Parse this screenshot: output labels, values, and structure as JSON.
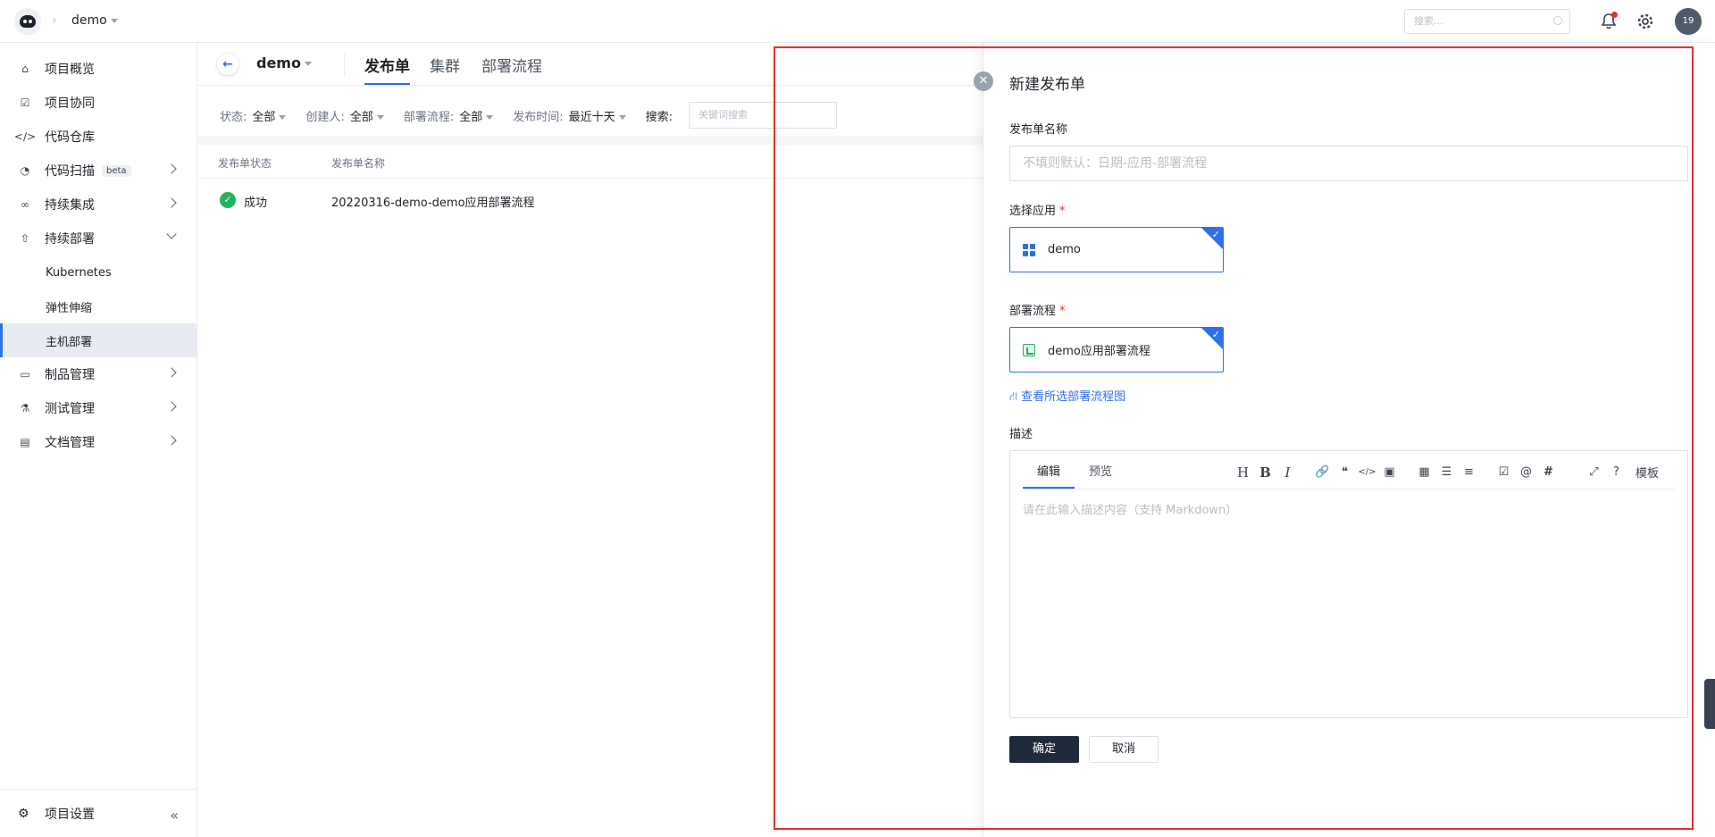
{
  "topbar": {
    "project": "demo",
    "search_placeholder": "搜索...",
    "avatar": "19",
    "icons": [
      "bell-icon",
      "gear-icon"
    ]
  },
  "sidebar": {
    "items": [
      {
        "label": "项目概览",
        "icon": "home-icon"
      },
      {
        "label": "项目协同",
        "icon": "check-square-icon"
      },
      {
        "label": "代码仓库",
        "icon": "code-icon"
      },
      {
        "label": "代码扫描",
        "icon": "scan-icon",
        "badge": "beta"
      },
      {
        "label": "持续集成",
        "icon": "infinity-icon"
      },
      {
        "label": "持续部署",
        "icon": "rocket-icon"
      },
      {
        "label": "Kubernetes"
      },
      {
        "label": "弹性伸缩"
      },
      {
        "label": "主机部署"
      },
      {
        "label": "制品管理",
        "icon": "box-icon"
      },
      {
        "label": "测试管理",
        "icon": "flask-icon"
      },
      {
        "label": "文档管理",
        "icon": "book-icon"
      }
    ],
    "settings": "项目设置",
    "collapse": "«"
  },
  "main": {
    "app_name": "demo",
    "tabs": [
      "发布单",
      "集群",
      "部署流程"
    ],
    "filters": {
      "status_label": "状态:",
      "status_value": "全部",
      "creator_label": "创建人:",
      "creator_value": "全部",
      "flow_label": "部署流程:",
      "flow_value": "全部",
      "time_label": "发布时间:",
      "time_value": "最近十天",
      "search_label": "搜索:",
      "search_placeholder": "关键词搜索"
    },
    "table": {
      "headers": [
        "发布单状态",
        "发布单名称"
      ],
      "rows": [
        {
          "status": "成功",
          "name": "20220316-demo-demo应用部署流程"
        }
      ]
    }
  },
  "drawer": {
    "title": "新建发布单",
    "name_label": "发布单名称",
    "name_placeholder": "不填则默认：日期-应用-部署流程",
    "app_label": "选择应用",
    "app_value": "demo",
    "flow_label": "部署流程",
    "flow_value": "demo应用部署流程",
    "flow_link": "查看所选部署流程图",
    "desc_label": "描述",
    "editor": {
      "tab_edit": "编辑",
      "tab_preview": "预览",
      "placeholder": "请在此输入描述内容（支持 Markdown）",
      "toolbar": [
        "H",
        "B",
        "I",
        "🔗",
        "❝",
        "</>",
        "▣",
        "▦",
        "☰",
        "≡",
        "☑",
        "@",
        "#",
        "⤢",
        "?",
        "模板"
      ]
    },
    "confirm": "确定",
    "cancel": "取消"
  },
  "colors": {
    "accent": "#2f6feb",
    "success": "#21b25f",
    "highlight_box": "#e5312d"
  }
}
